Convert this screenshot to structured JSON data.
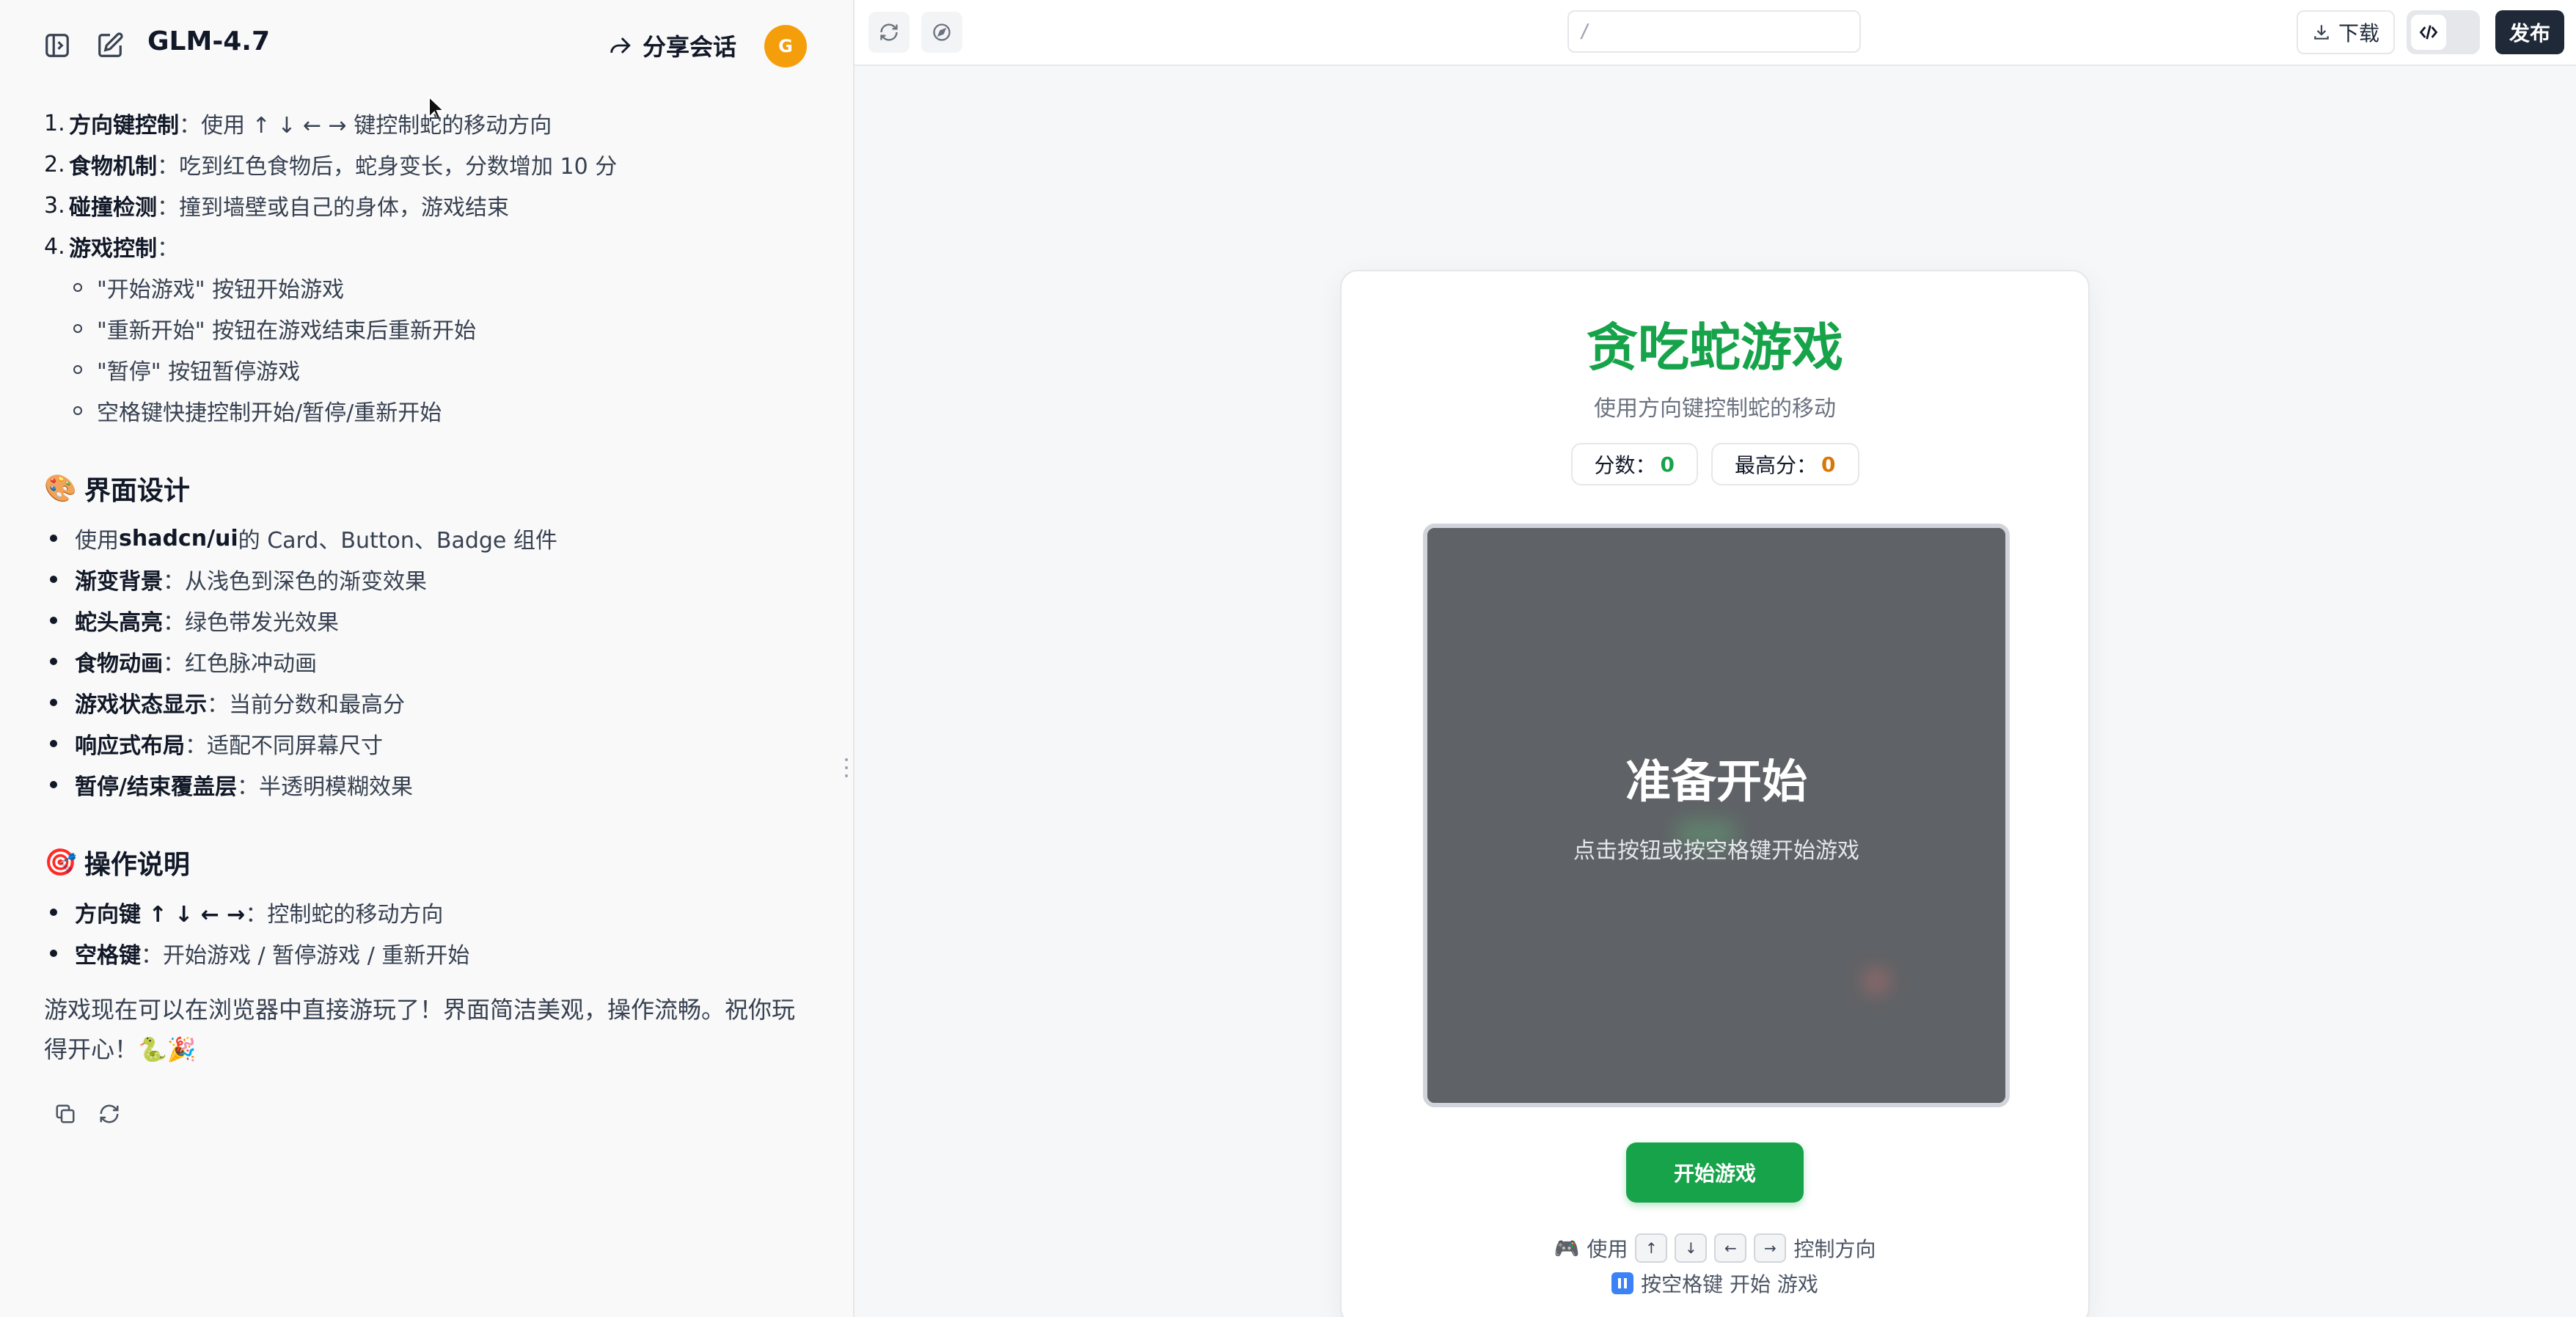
{
  "chat": {
    "model_name": "GLM-4.7",
    "share_label": "分享会话",
    "avatar_initial": "G",
    "features": [
      {
        "num": "1.",
        "bold": "方向键控制",
        "text": "：使用 ↑ ↓ ← → 键控制蛇的移动方向"
      },
      {
        "num": "2.",
        "bold": "食物机制",
        "text": "：吃到红色食物后，蛇身变长，分数增加 10 分"
      },
      {
        "num": "3.",
        "bold": "碰撞检测",
        "text": "：撞到墙壁或自己的身体，游戏结束"
      },
      {
        "num": "4.",
        "bold": "游戏控制",
        "text": "："
      }
    ],
    "controls_sub": [
      "\"开始游戏\" 按钮开始游戏",
      "\"重新开始\" 按钮在游戏结束后重新开始",
      "\"暂停\" 按钮暂停游戏",
      "空格键快捷控制开始/暂停/重新开始"
    ],
    "design_title": "界面设计",
    "design_emoji": "🎨",
    "design_items": [
      {
        "pre": "使用 ",
        "bold": "shadcn/ui",
        "text": " 的 Card、Button、Badge 组件"
      },
      {
        "pre": "",
        "bold": "渐变背景",
        "text": "：从浅色到深色的渐变效果"
      },
      {
        "pre": "",
        "bold": "蛇头高亮",
        "text": "：绿色带发光效果"
      },
      {
        "pre": "",
        "bold": "食物动画",
        "text": "：红色脉冲动画"
      },
      {
        "pre": "",
        "bold": "游戏状态显示",
        "text": "：当前分数和最高分"
      },
      {
        "pre": "",
        "bold": "响应式布局",
        "text": "：适配不同屏幕尺寸"
      },
      {
        "pre": "",
        "bold": "暂停/结束覆盖层",
        "text": "：半透明模糊效果"
      }
    ],
    "ops_title": "操作说明",
    "ops_emoji": "🎯",
    "ops_items": [
      {
        "bold": "方向键 ↑ ↓ ← →",
        "text": "：控制蛇的移动方向"
      },
      {
        "bold": "空格键",
        "text": "：开始游戏 / 暂停游戏 / 重新开始"
      }
    ],
    "closing": "游戏现在可以在浏览器中直接游玩了！界面简洁美观，操作流畅。祝你玩得开心！🐍🎉"
  },
  "preview": {
    "url_value": "/",
    "download_label": "下载",
    "publish_label": "发布",
    "game": {
      "title": "贪吃蛇游戏",
      "subtitle": "使用方向键控制蛇的移动",
      "score_label": "分数：",
      "score_value": "0",
      "high_label": "最高分：",
      "high_value": "0",
      "overlay_title": "准备开始",
      "overlay_hint": "点击按钮或按空格键开始游戏",
      "start_label": "开始游戏",
      "help_use": "使用",
      "help_direction": "控制方向",
      "keys": [
        "↑",
        "↓",
        "←",
        "→"
      ],
      "help_space": "按空格键 开始 游戏",
      "gamepad_emoji": "🎮"
    }
  },
  "colors": {
    "accent_green": "#16a34a",
    "high_score_orange": "#d97706",
    "avatar": "#f59e0b"
  }
}
